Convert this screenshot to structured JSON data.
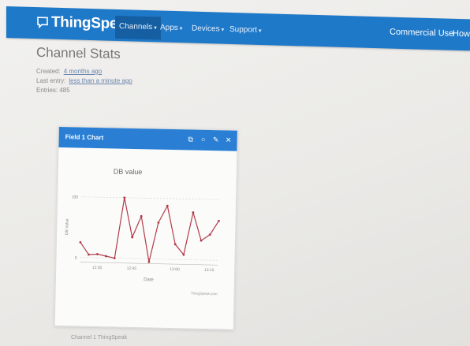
{
  "navbar": {
    "brand": "ThingSpeak",
    "brand_mark": "™",
    "items": [
      {
        "label": "Channels",
        "active": true
      },
      {
        "label": "Apps",
        "active": false
      },
      {
        "label": "Devices",
        "active": false
      },
      {
        "label": "Support",
        "active": false
      }
    ],
    "right": [
      "Commercial Use",
      "How to"
    ]
  },
  "page": {
    "title": "Channel Stats",
    "created_label": "Created:",
    "created_value": "4 months ago",
    "last_entry_label": "Last entry:",
    "last_entry_value": "less than a minute ago",
    "entries_label": "Entries:",
    "entries_value": "485"
  },
  "panel": {
    "title": "Field 1 Chart",
    "tool_icons": [
      "external-link-icon",
      "comment-icon",
      "pencil-icon",
      "close-icon"
    ]
  },
  "chart_data": {
    "type": "line",
    "title": "DB value",
    "xlabel": "Date",
    "ylabel": "DB Value",
    "x": [
      "12:30",
      "",
      "12:45",
      "",
      "",
      "",
      "",
      "",
      "",
      "",
      "13:00",
      "",
      "",
      "",
      "",
      "",
      "",
      "13:15",
      "",
      "",
      ""
    ],
    "x_ticks": [
      "12:30",
      "12:45",
      "13:00",
      "13:15"
    ],
    "y_ticks": [
      0,
      100
    ],
    "ylim": [
      0,
      100
    ],
    "series": [
      {
        "values": [
          25,
          5,
          6,
          3,
          0,
          100,
          35,
          70,
          -5,
          60,
          88,
          25,
          8,
          78,
          32,
          42,
          65
        ]
      }
    ],
    "grid": true,
    "color": "#b33a4a",
    "credit": "ThingSpeak.com"
  },
  "footer": {
    "text": "Channel 1 ThingSpeak"
  },
  "colors": {
    "nav": "#1f79c9",
    "panel_header": "#2a7fd4",
    "series": "#b33a4a"
  }
}
